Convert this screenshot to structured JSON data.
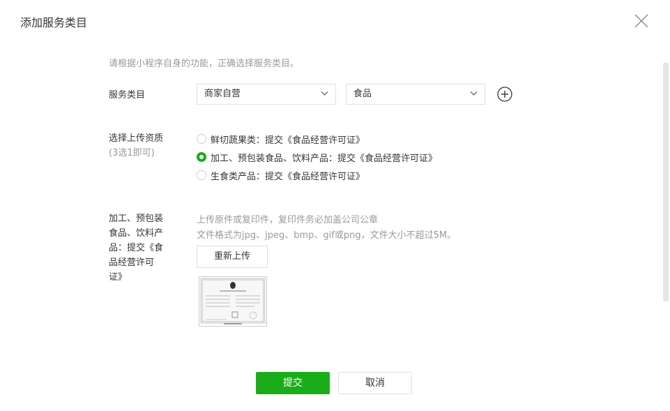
{
  "dialog": {
    "title": "添加服务类目",
    "hint": "请根据小程序自身的功能，正确选择服务类目。"
  },
  "service_category": {
    "label": "服务类目",
    "select1_value": "商家自营",
    "select2_value": "食品"
  },
  "qualification": {
    "label": "选择上传资质",
    "sub_label": "(3选1即可)",
    "options": [
      {
        "label": "鲜切蔬果类：提交《食品经营许可证》",
        "checked": false
      },
      {
        "label": "加工、预包装食品、饮料产品：提交《食品经营许可证》",
        "checked": true
      },
      {
        "label": "生食类产品：提交《食品经营许可证》",
        "checked": false
      }
    ]
  },
  "upload": {
    "label_lines": [
      "加工、预包装",
      "食品、饮料产",
      "品：提交《食",
      "品经营许可",
      "证》"
    ],
    "hint1": "上传原件或复印件，复印件务必加盖公司公章",
    "hint2": "文件格式为jpg、jpeg、bmp、gif或png，文件大小不超过5M。",
    "reupload_label": "重新上传"
  },
  "actions": {
    "submit_label": "提交",
    "cancel_label": "取消"
  },
  "colors": {
    "accent": "#1aad19",
    "muted_text": "#9a9a9a",
    "text": "#353535",
    "border": "#e0e0e0"
  }
}
